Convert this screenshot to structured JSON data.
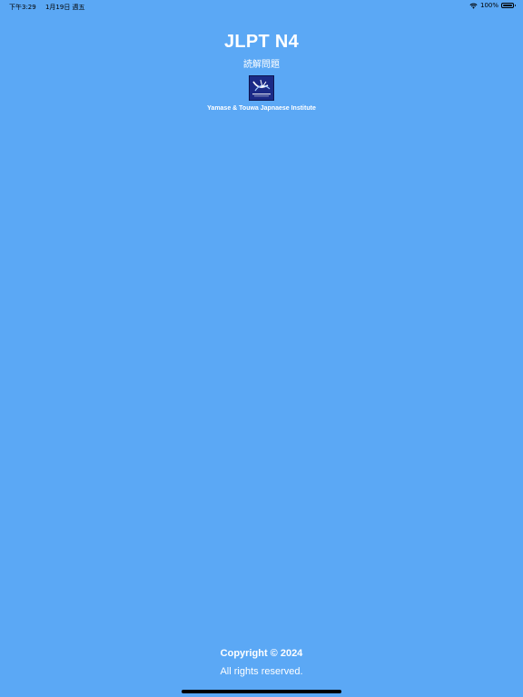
{
  "status_bar": {
    "time": "下午3:29",
    "date": "1月19日 週五",
    "battery_text": "100%",
    "battery_level": 1.0,
    "icons": [
      "wifi-icon",
      "battery-icon"
    ]
  },
  "header": {
    "title": "JLPT N4",
    "subtitle": "読解問題",
    "logo_text": "YAMASE & TOUWA",
    "institute": "Yamase & Touwa Japnaese Institute"
  },
  "footer": {
    "copyright": "Copyright © 2024",
    "rights": "All rights reserved."
  },
  "colors": {
    "background": "#5BA8F5",
    "logo_background": "#1B2A86",
    "text": "#FFFFFF"
  }
}
